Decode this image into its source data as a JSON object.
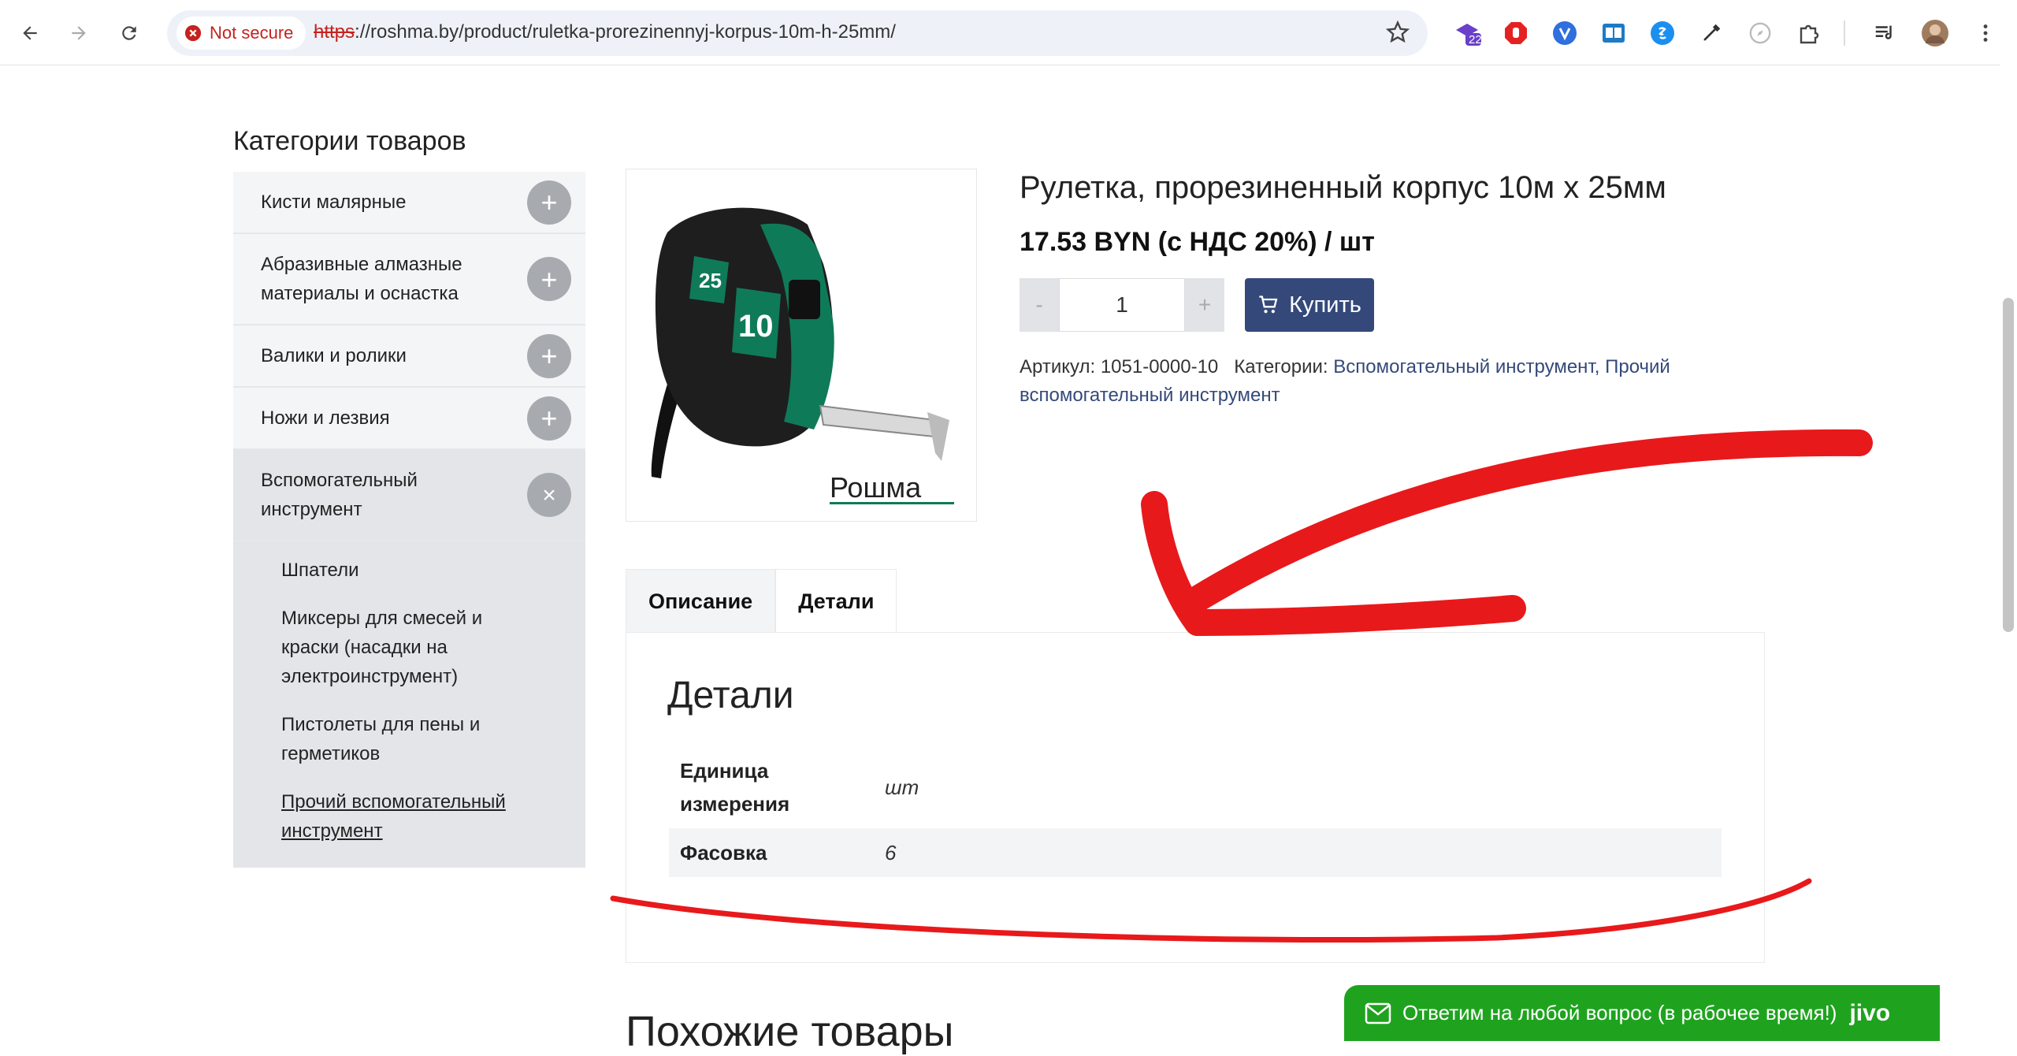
{
  "browser": {
    "security_label": "Not secure",
    "url_protocol": "https",
    "url_rest": "://roshma.by/product/ruletka-prorezinennyj-korpus-10m-h-25mm/",
    "extension_badge": "22"
  },
  "sidebar": {
    "title": "Категории товаров",
    "items": [
      {
        "label": "Кисти малярные",
        "toggle": "+"
      },
      {
        "label": "Абразивные алмазные материалы и оснастка",
        "toggle": "+"
      },
      {
        "label": "Валики и ролики",
        "toggle": "+"
      },
      {
        "label": "Ножи и лезвия",
        "toggle": "+"
      },
      {
        "label": "Вспомогательный инструмент",
        "toggle": "×"
      }
    ],
    "subitems": [
      "Шпатели",
      "Миксеры для смесей и краски (насадки на электроинструмент)",
      "Пистолеты для пены и герметиков",
      "Прочий вспомогательный инструмент"
    ]
  },
  "product": {
    "title": "Рулетка, прорезиненный корпус 10м х 25мм",
    "price": "17.53 BYN (с НДС 20%) / шт",
    "qty_minus": "-",
    "qty_value": "1",
    "qty_plus": "+",
    "buy_label": "Купить",
    "sku_label": "Артикул:",
    "sku_value": "1051-0000-10",
    "categories_label": "Категории:",
    "category_1": "Вспомогательный инструмент,",
    "category_2": "Прочий вспомогательный инструмент",
    "image_brand": "Рошма",
    "image_label_a": "25",
    "image_label_b": "10"
  },
  "tabs": {
    "description": "Описание",
    "details": "Детали"
  },
  "details": {
    "title": "Детали",
    "rows": [
      {
        "key": "Единица измерения",
        "value": "шт"
      },
      {
        "key": "Фасовка",
        "value": "6"
      }
    ]
  },
  "similar_title": "Похожие товары",
  "chat": {
    "message": "Ответим на любой вопрос (в рабочее время!)",
    "brand": "jivo"
  },
  "colors": {
    "accent": "#34497a",
    "chat_green": "#1fa31f",
    "annotation_red": "#e8191b"
  }
}
